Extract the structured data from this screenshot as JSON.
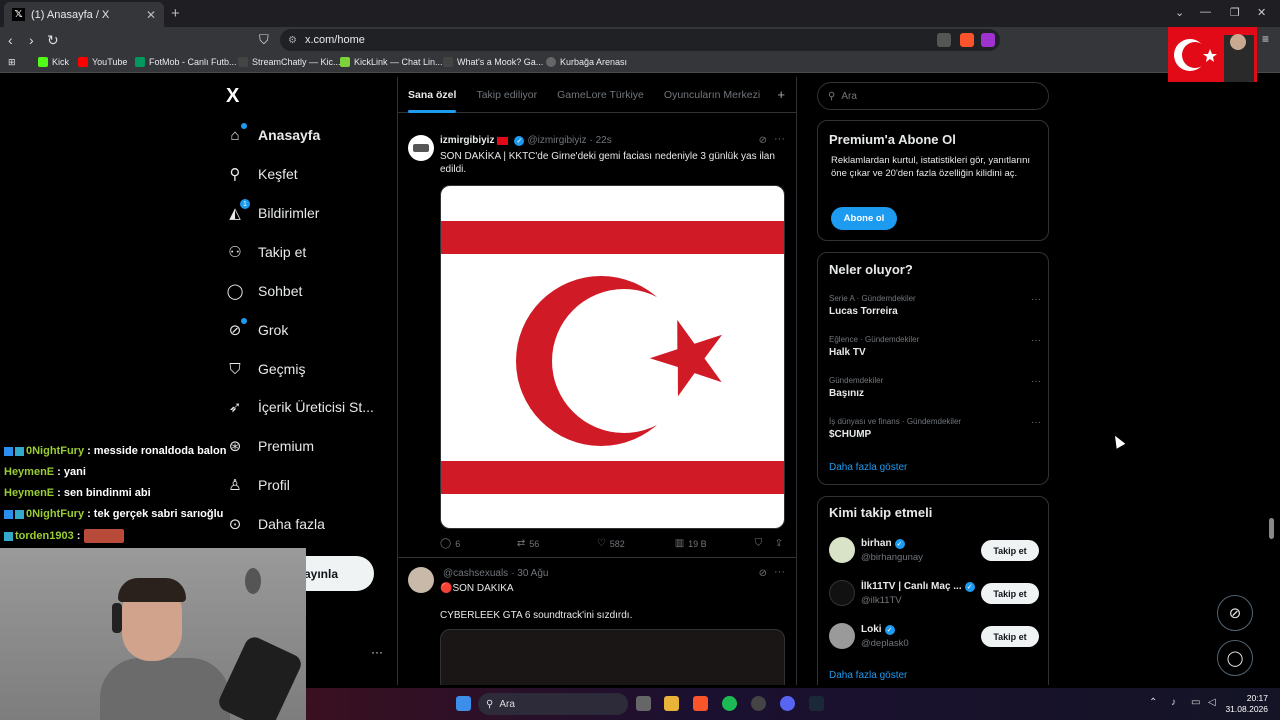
{
  "browser": {
    "tab_title": "(1) Anasayfa / X",
    "tab_close": "✕",
    "new_tab": "+",
    "url": "x.com/home",
    "bookmarks": [
      "Kick",
      "YouTube",
      "FotMob - Canlı Futb...",
      "StreamChatly — Kic...",
      "KickLink — Chat Lin...",
      "What's a Mook? Ga...",
      "Kurbağa Arenası"
    ],
    "bookmark_colors": [
      "#53fc18",
      "#ff0000",
      "#00985f",
      "#444444",
      "#7dd13b",
      "#444444",
      "#666666"
    ]
  },
  "sidebar": {
    "logo": "X",
    "items": [
      {
        "label": "Anasayfa",
        "icon": "home-icon",
        "glyph": "⌂"
      },
      {
        "label": "Keşfet",
        "icon": "search-icon",
        "glyph": "⚲"
      },
      {
        "label": "Bildirimler",
        "icon": "bell-icon",
        "glyph": "🔔"
      },
      {
        "label": "Takip et",
        "icon": "add-person-icon",
        "glyph": "⚇"
      },
      {
        "label": "Sohbet",
        "icon": "chat-icon",
        "glyph": "◯"
      },
      {
        "label": "Grok",
        "icon": "grok-icon",
        "glyph": "⊘"
      },
      {
        "label": "Geçmiş",
        "icon": "bookmark-icon",
        "glyph": "⛉"
      },
      {
        "label": "İçerik Üreticisi St...",
        "icon": "rocket-icon",
        "glyph": "➶"
      },
      {
        "label": "Premium",
        "icon": "premium-icon",
        "glyph": "⊛"
      },
      {
        "label": "Profil",
        "icon": "profile-icon",
        "glyph": "♙"
      },
      {
        "label": "Daha fazla",
        "icon": "more-circle-icon",
        "glyph": "⊙"
      }
    ],
    "notification_count": "1",
    "post_label": "ayınla",
    "more_dots": "···"
  },
  "timeline": {
    "tabs": [
      "Sana özel",
      "Takip ediliyor",
      "GameLore Türkiye",
      "Oyuncuların Merkezi"
    ],
    "tabs_plus": "+",
    "tweets": [
      {
        "name": "izmirgibiyiz",
        "handle": "@izmirgibiyiz",
        "time": "· 22s",
        "text": "SON DAKİKA | KKTC'de Girne'deki gemi faciası nedeniyle 3 günlük yas ilan edildi.",
        "replies": "6",
        "retweets": "56",
        "likes": "582",
        "views": "19 B"
      },
      {
        "name": "",
        "handle": "@cashsexuals",
        "time": "· 30 Ağu",
        "text": "🔴SON DAKIKA",
        "text2": "CYBERLEEK GTA 6 soundtrack'ini sızdırdı."
      }
    ]
  },
  "right": {
    "search_placeholder": "Ara",
    "premium": {
      "title": "Premium'a Abone Ol",
      "desc": "Reklamlardan kurtul, istatistikleri gör, yanıtlarını öne çıkar ve 20'den fazla özelliğin kilidini aç.",
      "button": "Abone ol"
    },
    "trends": {
      "title": "Neler oluyor?",
      "items": [
        {
          "context": "Serie A · Gündemdekiler",
          "name": "Lucas Torreira"
        },
        {
          "context": "Eğlence · Gündemdekiler",
          "name": "Halk TV"
        },
        {
          "context": "Gündemdekiler",
          "name": "Başınız"
        },
        {
          "context": "İş dünyası ve finans · Gündemdekiler",
          "name": "$CHUMP"
        }
      ],
      "show_more": "Daha fazla göster"
    },
    "who_to_follow": {
      "title": "Kimi takip etmeli",
      "items": [
        {
          "name": "birhan",
          "handle": "@birhangunay",
          "button": "Takip et"
        },
        {
          "name": "İlk11TV | Canlı Maç ...",
          "handle": "@ilk11TV",
          "button": "Takip et"
        },
        {
          "name": "Loki",
          "handle": "@deplask0",
          "button": "Takip et"
        }
      ],
      "show_more": "Daha fazla göster"
    }
  },
  "chat": [
    {
      "user": "0NightFury",
      "msg": ": messide ronaldoda balon",
      "badge": true
    },
    {
      "user": "HeymenE",
      "msg": ": yani",
      "badge": false
    },
    {
      "user": "HeymenE",
      "msg": ": sen bindinmi abi",
      "badge": false
    },
    {
      "user": "0NightFury",
      "msg": ": tek gerçek sabri sarıoğlu",
      "badge": true
    },
    {
      "user": "torden1903",
      "msg": " :",
      "badge": true
    }
  ],
  "taskbar": {
    "search": "Ara",
    "time": "20:17",
    "date": "31.08.2026"
  },
  "colors": {
    "accent": "#1d9bf0",
    "background": "#000000",
    "border": "#2f3336",
    "flag_red": "#e30a17"
  }
}
